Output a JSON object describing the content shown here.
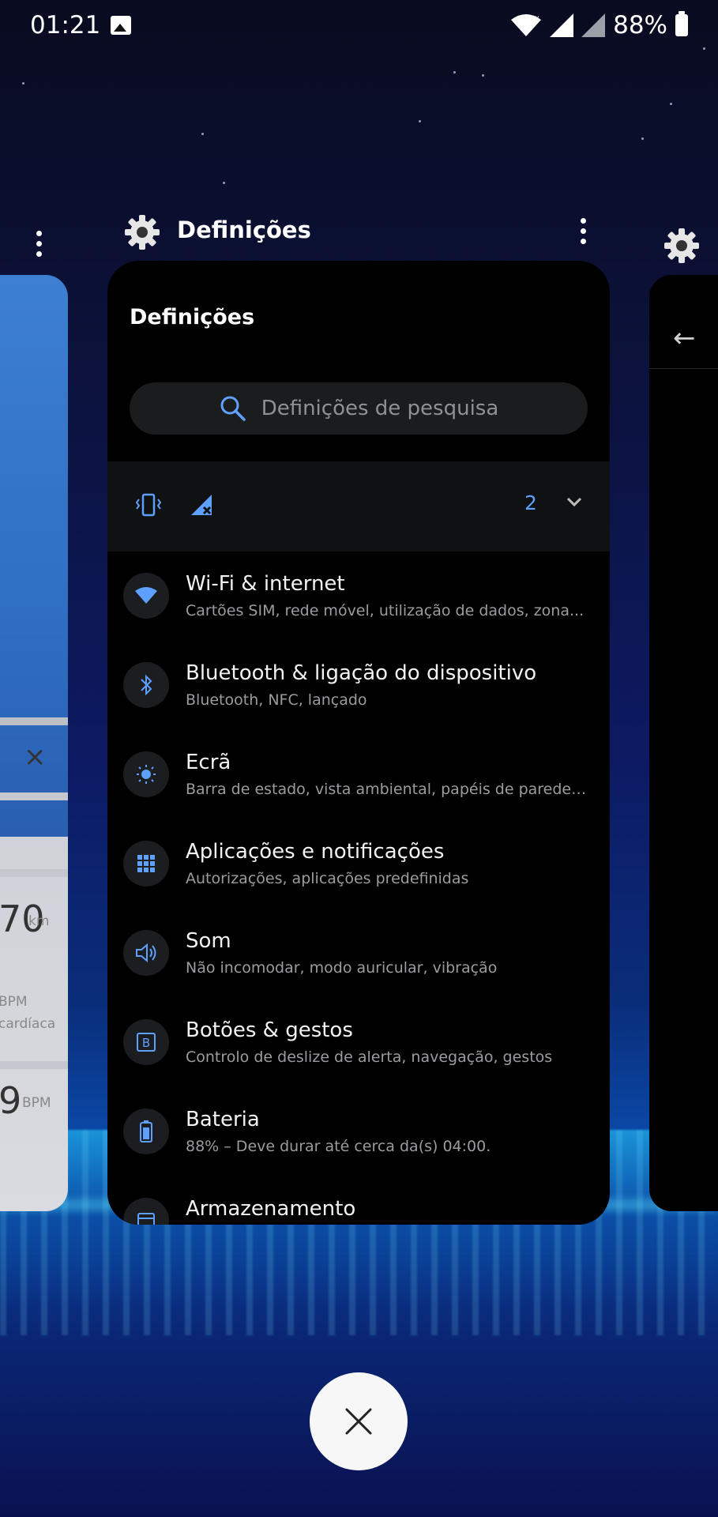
{
  "status_bar": {
    "time": "01:21",
    "battery_percent": "88%"
  },
  "left_card": {
    "close_symbol": "×",
    "distance_value": "70",
    "distance_unit": "km",
    "bpm_label": "BPM",
    "heart_label": "cardíaca",
    "bpm_value": "9",
    "bpm_unit": "BPM"
  },
  "main_card": {
    "app_name": "Definições",
    "page_title": "Definições",
    "search_placeholder": "Definições de pesquisa",
    "conditions_count": "2",
    "items": [
      {
        "title": "Wi-Fi & internet",
        "subtitle": "Cartões SIM, rede móvel, utilização de dados, zona..."
      },
      {
        "title": "Bluetooth & ligação do dispositivo",
        "subtitle": "Bluetooth, NFC, lançado"
      },
      {
        "title": "Ecrã",
        "subtitle": "Barra de estado, vista ambiental, papéis de parede,..."
      },
      {
        "title": "Aplicações e notificações",
        "subtitle": "Autorizações, aplicações predefinidas"
      },
      {
        "title": "Som",
        "subtitle": "Não incomodar, modo auricular, vibração"
      },
      {
        "title": "Botões & gestos",
        "subtitle": "Controlo de deslize de alerta, navegação, gestos"
      },
      {
        "title": "Bateria",
        "subtitle": "88% – Deve durar até cerca da(s) 04:00."
      },
      {
        "title": "Armazenamento",
        "subtitle": ""
      }
    ]
  },
  "colors": {
    "accent": "#5ea0ff",
    "card_bg": "#000000",
    "icon_bg": "#1c1d20"
  },
  "icons": {
    "items": [
      "wifi-icon",
      "bluetooth-icon",
      "brightness-icon",
      "apps-grid-icon",
      "speaker-icon",
      "button-b-icon",
      "battery-icon",
      "storage-icon"
    ]
  }
}
